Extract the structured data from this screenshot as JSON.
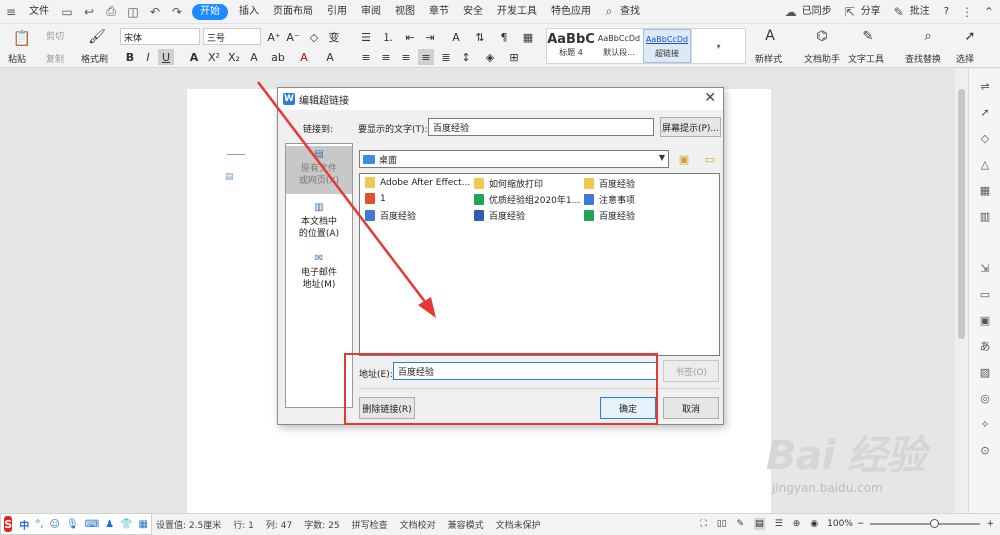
{
  "menubar": {
    "file": "文件",
    "tabs": [
      "开始",
      "插入",
      "页面布局",
      "引用",
      "审阅",
      "视图",
      "章节",
      "安全",
      "开发工具",
      "特色应用"
    ],
    "active_tab": "开始",
    "search": "查找",
    "sync": "已同步",
    "share": "分享",
    "comment": "批注",
    "help": "?"
  },
  "ribbon": {
    "paste": "粘贴",
    "cut": "剪切",
    "copy": "复制",
    "format_painter": "格式刷",
    "font_name": "宋体",
    "font_size": "三号",
    "styles": [
      {
        "preview": "AaBbC",
        "label": "标题 4"
      },
      {
        "preview": "AaBbCcDd",
        "label": "默认段..."
      },
      {
        "preview": "AaBbCcDd",
        "label": "超链接"
      }
    ],
    "new_style": "新样式",
    "doc_assistant": "文档助手",
    "text_tools": "文字工具",
    "find_replace": "查找替换",
    "select": "选择"
  },
  "dialog": {
    "title": "编辑超链接",
    "link_to_label": "链接到:",
    "display_text_label": "要显示的文字(T):",
    "display_text_value": "百度经验",
    "screen_tip_button": "屏幕提示(P)...",
    "link_options": [
      {
        "label": "原有文件\n或网页(X)",
        "icon": "file-web-icon",
        "selected": true
      },
      {
        "label": "本文档中\n的位置(A)",
        "icon": "document-place-icon",
        "selected": false
      },
      {
        "label": "电子邮件\n地址(M)",
        "icon": "email-icon",
        "selected": false
      }
    ],
    "folder": "桌面",
    "files": [
      {
        "name": "Adobe After Effect...",
        "type": "folder"
      },
      {
        "name": "如何缩放打印",
        "type": "folder"
      },
      {
        "name": "百度经验",
        "type": "folder"
      },
      {
        "name": "1",
        "type": "pdf"
      },
      {
        "name": "优质经验组2020年1...",
        "type": "sheet"
      },
      {
        "name": "注意事项",
        "type": "doc"
      },
      {
        "name": "百度经验",
        "type": "doc"
      },
      {
        "name": "百度经验",
        "type": "image"
      },
      {
        "name": "百度经验",
        "type": "sheet"
      }
    ],
    "address_label": "地址(E):",
    "address_value": "百度经验",
    "bookmark_button": "书签(O)",
    "remove_link_button": "删除链接(R)",
    "ok_button": "确定",
    "cancel_button": "取消"
  },
  "status": {
    "ime_lang": "中",
    "page_setting": "设置值: 2.5厘米",
    "row": "行: 1",
    "col": "列: 47",
    "word_count": "字数: 25",
    "spell_check": "拼写检查",
    "doc_proof": "文档校对",
    "compat_mode": "兼容模式",
    "doc_protect": "文档未保护",
    "zoom": "100%"
  },
  "watermark": {
    "brand": "Bai 经验",
    "url": "jingyan.baidu.com"
  },
  "colors": {
    "accent": "#1a8cff",
    "highlight_box": "#e53935"
  }
}
